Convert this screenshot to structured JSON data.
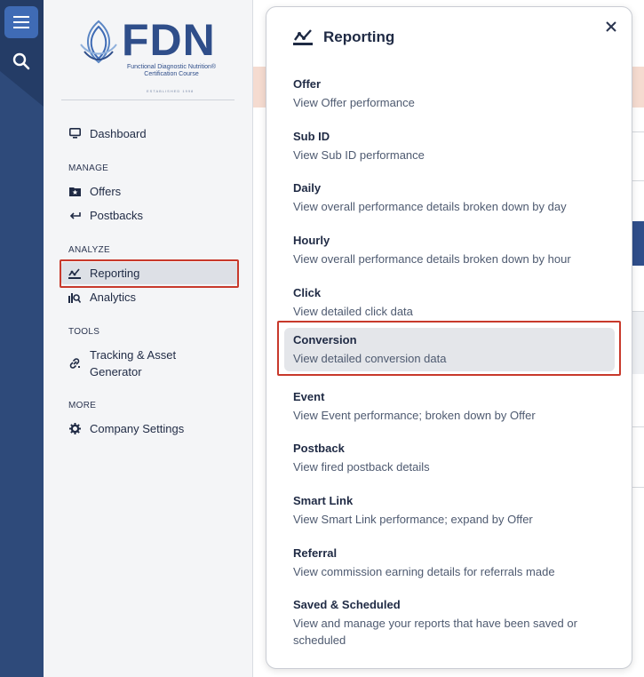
{
  "rail": {
    "menu_icon": "hamburger-menu-icon",
    "search_icon": "search-icon"
  },
  "logo": {
    "wordmark": "FDN",
    "tagline": "Functional Diagnostic Nutrition® Certification Course",
    "established": "ESTABLISHED 1998"
  },
  "sidebar": {
    "dashboard": "Dashboard",
    "manage_label": "MANAGE",
    "offers": "Offers",
    "postbacks": "Postbacks",
    "analyze_label": "ANALYZE",
    "reporting": "Reporting",
    "analytics": "Analytics",
    "tools_label": "TOOLS",
    "tracking": "Tracking & Asset Generator",
    "more_label": "MORE",
    "company_settings": "Company Settings"
  },
  "popover": {
    "title": "Reporting",
    "items": [
      {
        "title": "Offer",
        "desc": "View Offer performance"
      },
      {
        "title": "Sub ID",
        "desc": "View Sub ID performance"
      },
      {
        "title": "Daily",
        "desc": "View overall performance details broken down by day"
      },
      {
        "title": "Hourly",
        "desc": "View overall performance details broken down by hour"
      },
      {
        "title": "Click",
        "desc": "View detailed click data"
      },
      {
        "title": "Conversion",
        "desc": "View detailed conversion data"
      },
      {
        "title": "Event",
        "desc": "View Event performance; broken down by Offer"
      },
      {
        "title": "Postback",
        "desc": "View fired postback details"
      },
      {
        "title": "Smart Link",
        "desc": "View Smart Link performance; expand by Offer"
      },
      {
        "title": "Referral",
        "desc": "View commission earning details for referrals made"
      },
      {
        "title": "Saved & Scheduled",
        "desc": "View and manage your reports that have been saved or scheduled"
      }
    ]
  },
  "colors": {
    "rail": "#2e4a7a",
    "accent_blue": "#3f6bb5",
    "highlight": "#c8392b",
    "brand": "#2f4e8a"
  }
}
